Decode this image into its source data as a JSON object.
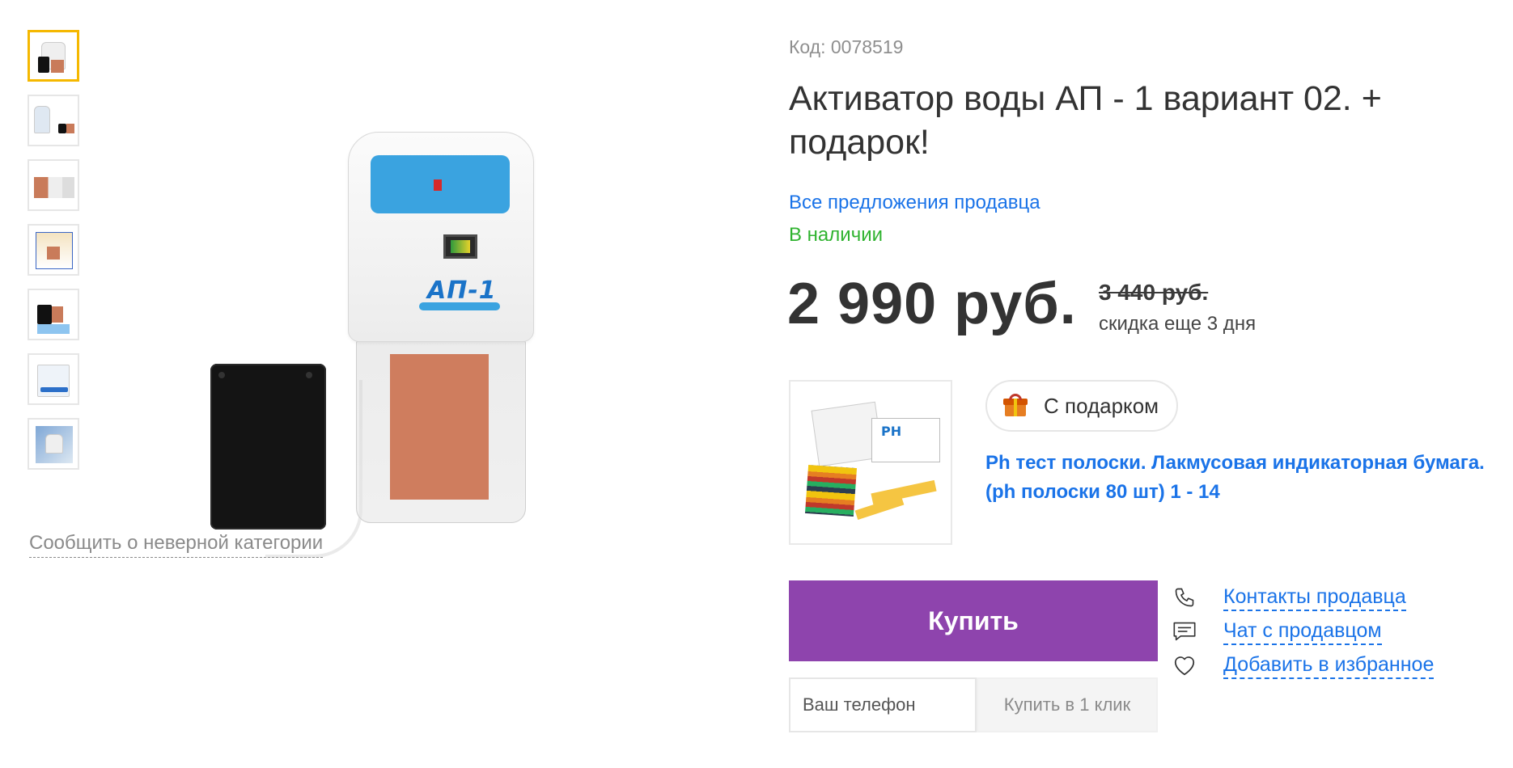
{
  "gallery": {
    "thumbnails": [
      {
        "name": "thumb-1",
        "active": true
      },
      {
        "name": "thumb-2",
        "active": false
      },
      {
        "name": "thumb-3",
        "active": false
      },
      {
        "name": "thumb-4",
        "active": false
      },
      {
        "name": "thumb-5",
        "active": false
      },
      {
        "name": "thumb-6",
        "active": false
      },
      {
        "name": "thumb-7",
        "active": false
      }
    ],
    "product_image_label": "АП-1",
    "report_link": "Сообщить о неверной категории"
  },
  "product": {
    "code": "Код: 0078519",
    "title": "Активатор воды АП - 1 вариант 02. + подарок!",
    "seller_offers_link": "Все предложения продавца",
    "stock": "В наличии",
    "price": "2 990 руб.",
    "old_price": "3 440 руб.",
    "discount_note": "скидка еще 3 дня"
  },
  "gift": {
    "badge_label": "С подарком",
    "image_text": "PH",
    "name": "Ph тест полоски. Лакмусовая индикаторная бумага. (ph полоски 80 шт) 1 - 14"
  },
  "purchase": {
    "buy_label": "Купить",
    "phone_placeholder": "Ваш телефон",
    "one_click_label": "Купить в 1 клик"
  },
  "actions": [
    {
      "icon": "phone-icon",
      "label": "Контакты продавца"
    },
    {
      "icon": "chat-icon",
      "label": "Чат с продавцом"
    },
    {
      "icon": "heart-icon",
      "label": "Добавить в избранное"
    }
  ],
  "colors": {
    "accent_purple": "#8e44ad",
    "link_blue": "#1a73e8",
    "stock_green": "#2fb32f",
    "thumb_active": "#f5b800"
  }
}
